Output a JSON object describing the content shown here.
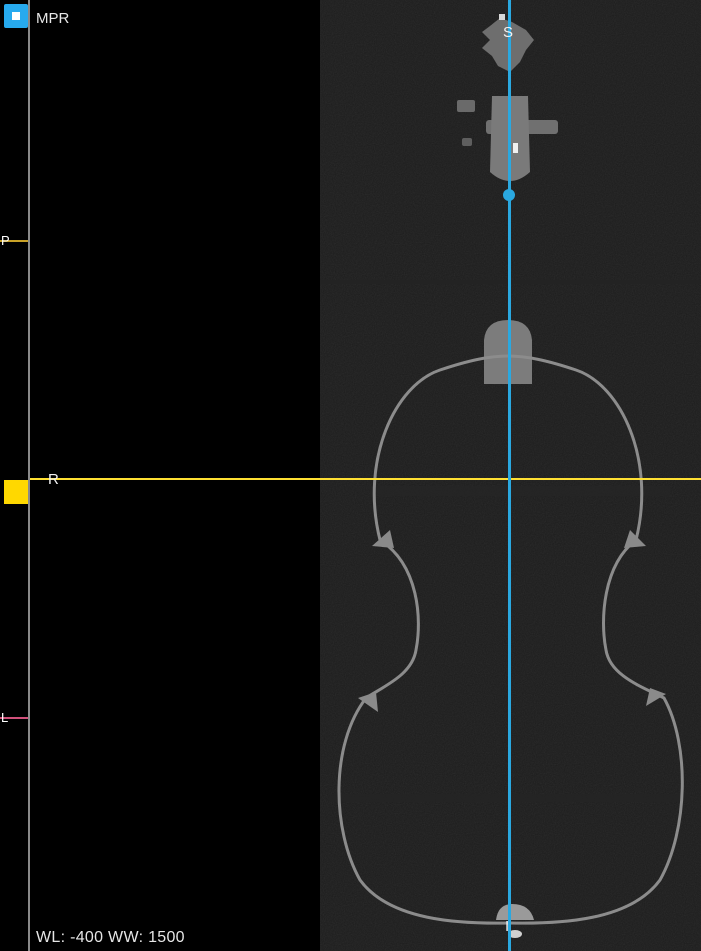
{
  "viewport": {
    "mode_label": "MPR",
    "window_level_text": "WL: -400 WW: 1500"
  },
  "orientation": {
    "top": "S",
    "bottom": "I",
    "left_crosshair": "R"
  },
  "ruler": {
    "markers": [
      {
        "label": "P",
        "color": "#c9a227"
      },
      {
        "label": "L",
        "color": "#d0507a"
      }
    ]
  },
  "crosshair": {
    "horizontal_color": "#ffe033",
    "vertical_color": "#2aa8e0"
  },
  "icons": {
    "mode_toggle": "square-icon",
    "vertical_handle": "circle-handle-icon",
    "horizontal_handle": "square-handle-icon"
  }
}
